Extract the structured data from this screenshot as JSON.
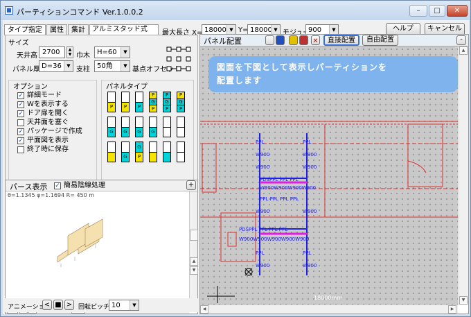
{
  "window": {
    "title": "パーティションコマンド Ver.1.0.0.2",
    "min": "–",
    "max": "□",
    "close": "✕"
  },
  "tabs": [
    "タイプ指定",
    "属性",
    "集計",
    "アルミスタッド式"
  ],
  "top": {
    "max_len_label": "最大長さ X=",
    "max_len": "18000",
    "y_label": "Y=",
    "y_value": "18000",
    "module_label": "モジュール",
    "module": "900",
    "help": "ヘルプ",
    "cancel": "キャンセル"
  },
  "size": {
    "group": "サイズ",
    "ceiling_label": "天井高",
    "ceiling": "2700",
    "width_label": "巾木",
    "width": "H=60",
    "panel_label": "パネル厚",
    "panel": "D=36",
    "column_label": "支柱",
    "column": "50角",
    "offset_label": "基点オフセット"
  },
  "options": {
    "group": "オプション",
    "items": [
      {
        "label": "詳細モード",
        "checked": true
      },
      {
        "label": "Wを表示する",
        "checked": true
      },
      {
        "label": "ドア扉を開く",
        "checked": true
      },
      {
        "label": "天井面を塞ぐ",
        "checked": false
      },
      {
        "label": "パッケージで作成",
        "checked": true
      },
      {
        "label": "平面図を表示",
        "checked": true
      },
      {
        "label": "終了時に保存",
        "checked": false
      }
    ]
  },
  "panel_types": {
    "group": "パネルタイプ"
  },
  "perspective": {
    "title": "パース表示",
    "simple_label": "簡易陰線処理",
    "simple_checked": true,
    "params": "θ=1.1345 φ=1.1694 R= 450 m",
    "plus": "+"
  },
  "animation": {
    "label": "アニメーション",
    "prev": "<",
    "stop": "■",
    "next": ">",
    "pitch_label": "回転ピッチ",
    "pitch": "10"
  },
  "plan": {
    "title": "パネル配置",
    "direct": "直接配置",
    "free": "自由配置",
    "banner_line1": "図面を下図として表示しパーティションを",
    "banner_line2": "配置します",
    "scale": "18000mm",
    "minus": "-"
  },
  "colors": {
    "accent": "#7fb3ee",
    "plan_line": "#e03030",
    "partition": "#2020e0"
  }
}
